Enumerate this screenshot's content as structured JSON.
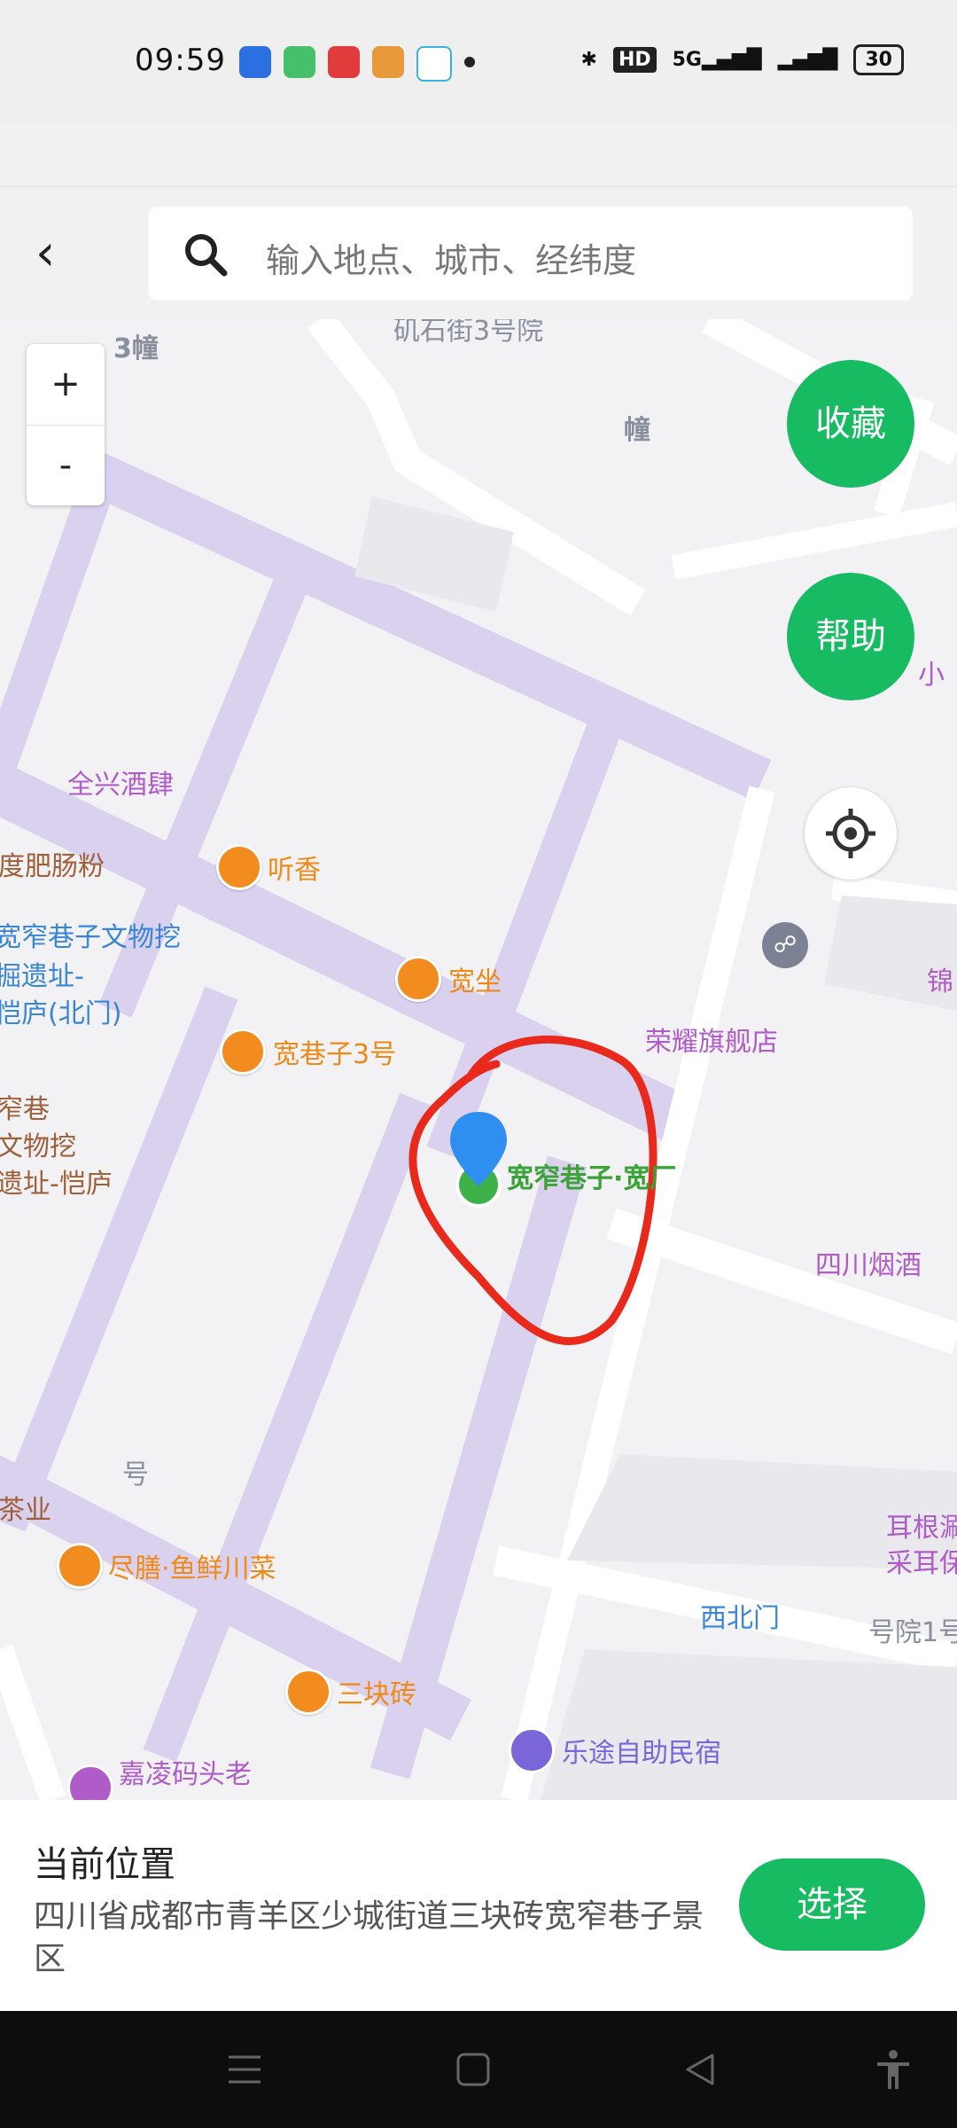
{
  "status_bar": {
    "time": "09:59",
    "battery": "30",
    "network": "5G",
    "hd_badge": "HD"
  },
  "topbar": {
    "search_placeholder": "输入地点、城市、经纬度"
  },
  "map": {
    "zoom_in": "+",
    "zoom_out": "-",
    "collect_button": "收藏",
    "help_button": "帮助",
    "pois": {
      "p1": "矶石街3号院",
      "p2": "3幢",
      "p3": "幢",
      "p4": "全兴酒肆",
      "p5": "度肥肠粉",
      "p6": "听香",
      "p7": "宽窄巷子文物挖",
      "p8": "掘遗址-",
      "p9": "恺庐(北门)",
      "p10": "宽坐",
      "p11": "荣耀旗舰店",
      "p12": "宽巷子3号",
      "p13": "窄巷",
      "p14": "文物挖",
      "p15": "遗址-恺庐",
      "p16": "宽窄巷子·宽厂",
      "p17": "四川烟酒",
      "p18": "号",
      "p19": "茶业",
      "p20": "尽膳·鱼鲜川菜",
      "p21": "耳根涮",
      "p22": "采耳保",
      "p23": "西北门",
      "p24": "号院1号",
      "p25": "三块砖",
      "p26": "乐途自助民宿",
      "p27": "嘉凌码头老",
      "p28": "小",
      "p29": "锦"
    }
  },
  "bottom": {
    "title": "当前位置",
    "address": "四川省成都市青羊区少城街道三块砖宽窄巷子景区",
    "select_button": "选择"
  },
  "colors": {
    "accent_green": "#17bb62",
    "road_purple": "#d8d0ec",
    "marker_blue": "#2f8ff0",
    "annotation_red": "#e8291c"
  }
}
